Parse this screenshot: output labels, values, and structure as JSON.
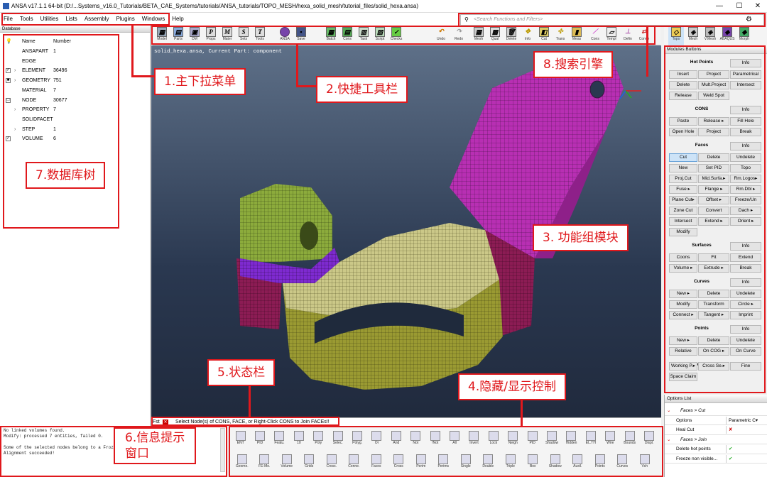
{
  "window": {
    "title": "ANSA v17.1.1 64-bit (D:/...Systems_v16.0_Tutorials/BETA_CAE_Systems/tutorials/ANSA_tutorials/TOPO_MESH/hexa_solid_mesh/tutorial_files/solid_hexa.ansa)",
    "minimize": "—",
    "maximize": "☐",
    "close": "✕"
  },
  "menu": [
    "File",
    "Tools",
    "Utilities",
    "Lists",
    "Assembly",
    "Plugins",
    "Windows",
    "Help"
  ],
  "search": {
    "placeholder": "<Search Functions and Filters>"
  },
  "toolbar": {
    "groups": [
      [
        "Model",
        "Parts",
        "DM",
        "Props",
        "Mater",
        "Sets",
        "Tools"
      ],
      [
        "ANSA",
        "Save"
      ],
      [
        "Batch",
        "Cons",
        "Task",
        "Script",
        "Checks"
      ],
      [
        "Undo",
        "Redo",
        "Mesh",
        "Qual",
        "Delete",
        "Info",
        "Cut",
        "Trans",
        "Meas"
      ],
      [
        "Cons",
        "Templ",
        "Defin",
        "Conve"
      ]
    ],
    "right": [
      "Topo",
      "Mesh",
      "V.Mesh",
      "ABAQUS",
      "Morph"
    ]
  },
  "database": {
    "header": "Database",
    "col_name": "Name",
    "col_number": "Number",
    "rows": [
      {
        "name": "ANSAPART",
        "number": "1",
        "check": "",
        "expand": ""
      },
      {
        "name": "EDGE",
        "number": "",
        "check": "",
        "expand": ""
      },
      {
        "name": "ELEMENT",
        "number": "36496",
        "check": "✓",
        "expand": "›"
      },
      {
        "name": "GEOMETRY",
        "number": "751",
        "check": "■",
        "expand": "›"
      },
      {
        "name": "MATERIAL",
        "number": "7",
        "check": "",
        "expand": ""
      },
      {
        "name": "NODE",
        "number": "30677",
        "check": "□",
        "expand": ""
      },
      {
        "name": "PROPERTY",
        "number": "7",
        "check": "",
        "expand": "›"
      },
      {
        "name": "SOLIDFACET",
        "number": "",
        "check": "",
        "expand": ""
      },
      {
        "name": "STEP",
        "number": "1",
        "check": "",
        "expand": "›"
      },
      {
        "name": "VOLUME",
        "number": "6",
        "check": "✓",
        "expand": ""
      }
    ]
  },
  "viewport": {
    "info": "solid_hexa.ansa,  Current Part: component"
  },
  "status": {
    "prefix": "Fst",
    "message": "Select Node(s) of CONS, FACE, or Right-Click CONS to Join FACEs!!"
  },
  "messages": [
    "No linked volumes found.",
    "Modify: processed 7 entities, failed 0.",
    "",
    "Some of the selected nodes belong to a Frozen face.",
    " Alignment succeeded!"
  ],
  "bottom_toolbar": {
    "row1": [
      "ENT",
      "PID",
      "Featu.",
      "10",
      "Poly",
      "Selec.",
      "Polyg.",
      "Or",
      "And",
      "Not",
      "!Not",
      "All",
      "Invert",
      "Lock",
      "Neigh",
      "PID",
      "Shadow",
      "Hidden",
      "EL.TH",
      "Wire",
      "Bounds",
      "Displ."
    ],
    "row2": [
      "Geome.",
      "FE-Mo.",
      "Volume",
      "Grids",
      "Cross.",
      "Conne.",
      "Faces",
      "Cross",
      "Perim",
      "Perims",
      "Single",
      "Double",
      "Triple",
      "Box",
      "Shadow",
      "Auxil.",
      "Points",
      "Curves",
      "Vch"
    ]
  },
  "modules": {
    "header": "Modules Buttons",
    "sections": [
      {
        "title": "Hot Points",
        "rows": [
          [
            "Info"
          ],
          [
            "Insert",
            "Project",
            "Parametrical"
          ],
          [
            "Delete",
            "Mult.Project",
            "Intersect"
          ],
          [
            "Release",
            "Weld Spot"
          ]
        ]
      },
      {
        "title": "CONS",
        "rows": [
          [
            "Info"
          ],
          [
            "Paste",
            "Release ▸",
            "Fill Hole"
          ],
          [
            "Open Hole",
            "Project",
            "Break"
          ]
        ]
      },
      {
        "title": "Faces",
        "rows": [
          [
            "Info"
          ],
          [
            "Cut",
            "Delete",
            "Undelete"
          ],
          [
            "New",
            "Set PID",
            "Topo"
          ],
          [
            "Proj.Cut",
            "Mid.Surfa.▸",
            "Rm.Logos▸"
          ],
          [
            "Fuse ▸",
            "Flange ▸",
            "Rm.Dbl ▸"
          ],
          [
            "Plane Cut▸",
            "Offset ▸",
            "Freeze/Un"
          ],
          [
            "Zone Cut",
            "Convert",
            "Dach ▸"
          ],
          [
            "Intersect",
            "Extend ▸",
            "Orient ▸"
          ],
          [
            "Modify"
          ]
        ]
      },
      {
        "title": "Surfaces",
        "rows": [
          [
            "Info"
          ],
          [
            "Coons",
            "Fit",
            "Extend"
          ],
          [
            "Volume ▸",
            "Extrude ▸",
            "Break"
          ]
        ]
      },
      {
        "title": "Curves",
        "rows": [
          [
            "Info"
          ],
          [
            "New ▸",
            "Delete",
            "Undelete"
          ],
          [
            "Modify",
            "Transform",
            "Circle ▸"
          ],
          [
            "Connect ▸",
            "Tangent ▸",
            "Imprint"
          ]
        ]
      },
      {
        "title": "Points",
        "rows": [
          [
            "Info"
          ],
          [
            "New ▸",
            "Delete",
            "Undelete"
          ],
          [
            "Relative",
            "On COG ▸",
            "On Curve"
          ]
        ]
      },
      {
        "title": "Auxiliaries",
        "rows": [
          [
            "Working P.▸",
            "Cross Se.▸",
            "Fine"
          ],
          [
            "Space Claim"
          ]
        ]
      }
    ]
  },
  "options": {
    "header": "Options List",
    "rows": [
      {
        "label": "Faces > Cut",
        "value": "",
        "kind": "group"
      },
      {
        "label": "Options",
        "value": "Parametric C▾",
        "kind": "opt"
      },
      {
        "label": "Heal Cut",
        "value": "✘",
        "kind": "opt"
      },
      {
        "label": "Faces > Join",
        "value": "",
        "kind": "group"
      },
      {
        "label": "Delete hot points",
        "value": "✔",
        "kind": "opt"
      },
      {
        "label": "Freeze non visible...",
        "value": "✔",
        "kind": "opt"
      }
    ]
  },
  "annotations": {
    "a1": "1.主下拉菜单",
    "a2": "2.快捷工具栏",
    "a3": "3. 功能组模块",
    "a4": "4.隐藏/显示控制",
    "a5": "5.状态栏",
    "a6a": "6.信息提示",
    "a6b": "窗口",
    "a7": "7.数据库树",
    "a8": "8.搜索引擎"
  },
  "colors": {
    "annotation": "#e0181c",
    "magenta_part": "#b82fb3",
    "yellow_part": "#c9c86a",
    "violet_part": "#7e2ad0",
    "maroon_part": "#8c1c54"
  }
}
